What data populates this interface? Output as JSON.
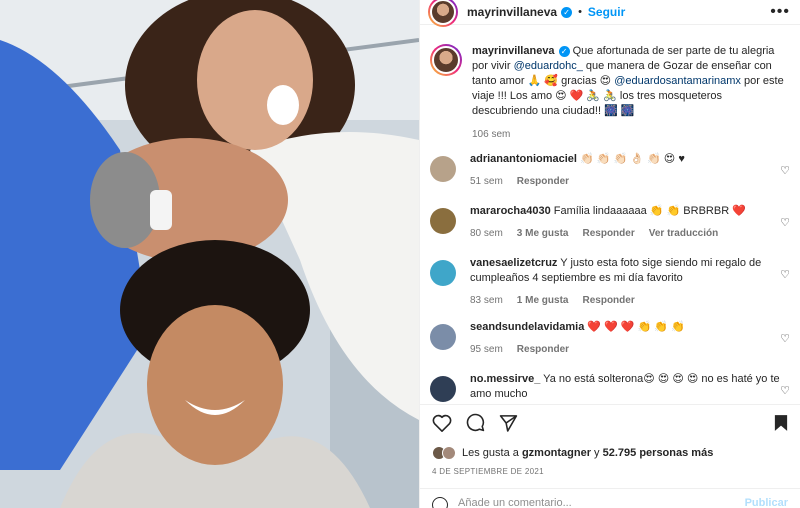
{
  "post": {
    "username": "mayrinvillaneva",
    "follow_label": "Seguir",
    "separator": "•",
    "more_label": "•••",
    "caption": {
      "username": "mayrinvillaneva",
      "text_1": " Que afortunada de ser parte de tu alegria por vivir ",
      "mention_1": "@eduardohc_",
      "text_2": " que manera de Gozar de enseñar con tanto amor 🙏 🥰 gracias 😍 ",
      "mention_2": "@eduardosantamarinamx",
      "text_3": " por este viaje !!! Los amo 😍 ❤️ 🚴 🚴 los tres mosqueteros descubriendo una ciudad!! 🎆 🎆",
      "time": "106 sem"
    }
  },
  "comments": [
    {
      "username": "adrianantoniomaciel",
      "text": " 👏🏻 👏🏻 👏🏻 👌🏻 👏🏻 😍 ♥",
      "time": "51 sem",
      "likes": "",
      "reply": "Responder",
      "translate": "",
      "avatar_color": "#b7a28a"
    },
    {
      "username": "mararocha4030",
      "text": " Família lindaaaaaa 👏 👏 BRBRBR ❤️",
      "time": "80 sem",
      "likes": "3 Me gusta",
      "reply": "Responder",
      "translate": "Ver traducción",
      "avatar_color": "#8a6e3e"
    },
    {
      "username": "vanesaelizetcruz",
      "text": " Y justo esta foto sige siendo mi regalo de cumpleaños 4 septiembre es mi día favorito",
      "time": "83 sem",
      "likes": "1 Me gusta",
      "reply": "Responder",
      "translate": "",
      "avatar_color": "#3fa6c9"
    },
    {
      "username": "seandsundelavidamia",
      "text": " ❤️ ❤️ ❤️ 👏 👏 👏",
      "time": "95 sem",
      "likes": "",
      "reply": "Responder",
      "translate": "",
      "avatar_color": "#7b8da8"
    },
    {
      "username": "no.messirve_",
      "text": " Ya no está solterona😍 😍 😍 😍 no es haté yo te amo mucho",
      "time": "",
      "likes": "",
      "reply": "",
      "translate": "",
      "avatar_color": "#2f3e55"
    }
  ],
  "likes": {
    "prefix": "Les gusta a ",
    "user": "gzmontagner",
    "middle": " y ",
    "count": "52.795 personas más"
  },
  "date": "4 DE SEPTIEMBRE DE 2021",
  "add_comment": {
    "placeholder": "Añade un comentario...",
    "publish": "Publicar"
  },
  "colors": {
    "accent": "#0095f6",
    "mention": "#00376b",
    "muted": "#737373"
  }
}
